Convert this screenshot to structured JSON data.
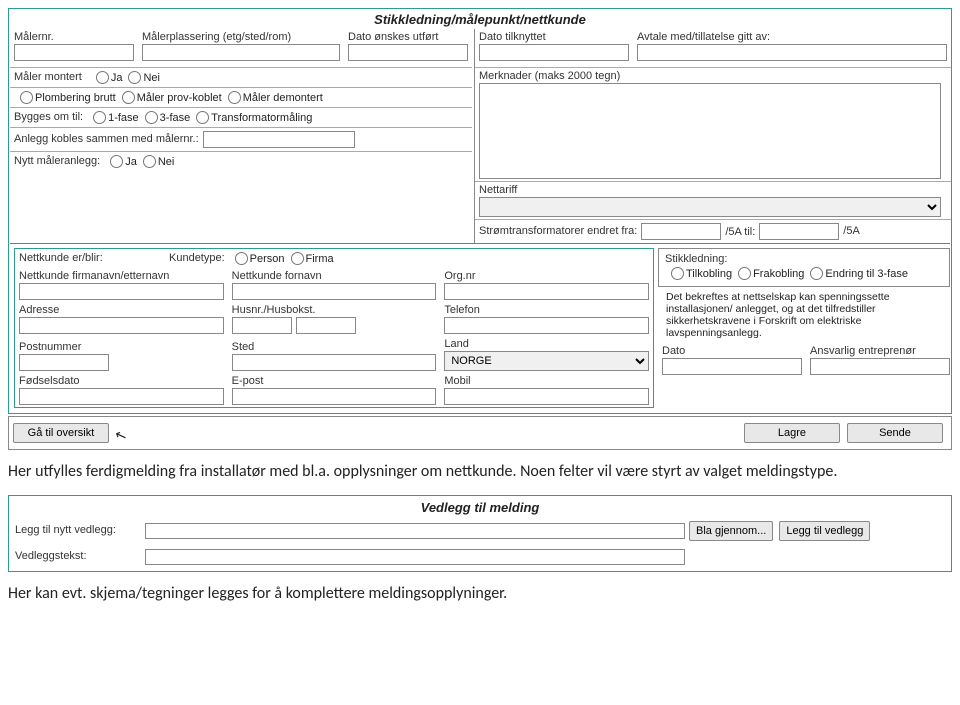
{
  "form1": {
    "title": "Stikkledning/målepunkt/nettkunde",
    "malernr": "Målernr.",
    "malerplassering": "Målerplassering (etg/sted/rom)",
    "dato_onsket": "Dato ønskes utført",
    "dato_tilknyttet": "Dato tilknyttet",
    "avtale": "Avtale med/tillatelse gitt av:",
    "merknader": "Merknader (maks 2000 tegn)",
    "maler_montert": "Måler montert",
    "ja": "Ja",
    "nei": "Nei",
    "plombering": "Plombering brutt",
    "provkoblet": "Måler prov-koblet",
    "demontert": "Måler demontert",
    "bygges_om": "Bygges om til:",
    "fase1": "1-fase",
    "fase3": "3-fase",
    "trafo": "Transformatormåling",
    "anlegg_kobles": "Anlegg kobles sammen med målernr.:",
    "nettariff": "Nettariff",
    "nytt_maler": "Nytt måleranlegg:",
    "stromtrans": "Strømtransformatorer endret fra:",
    "slash5a": "/5A til:",
    "slash5a2": "/5A",
    "nettkunde_erblir": "Nettkunde er/blir:",
    "kundetype": "Kundetype:",
    "person": "Person",
    "firma": "Firma",
    "stikkledning": "Stikkledning:",
    "tilkobling": "Tilkobling",
    "frakobling": "Frakobling",
    "endring3": "Endring til 3-fase",
    "firmanavn": "Nettkunde firmanavn/etternavn",
    "fornavn": "Nettkunde fornavn",
    "orgnr": "Org.nr",
    "bekreftes": "Det bekreftes at nettselskap kan spenningssette installasjonen/ anlegget, og at det tilfredstiller sikkerhetskravene i Forskrift om elektriske lavspenningsanlegg.",
    "adresse": "Adresse",
    "husnr": "Husnr./Husbokst.",
    "telefon": "Telefon",
    "postnummer": "Postnummer",
    "sted": "Sted",
    "land": "Land",
    "land_val": "NORGE",
    "fodselsdato": "Fødselsdato",
    "epost": "E-post",
    "mobil": "Mobil",
    "dato": "Dato",
    "ansvarlig": "Ansvarlig entreprenør"
  },
  "actions": {
    "oversikt": "Gå til oversikt",
    "lagre": "Lagre",
    "sende": "Sende"
  },
  "para1": "Her utfylles ferdigmelding fra installatør med bl.a. opplysninger om nettkunde. Noen felter vil være styrt av valget meldingstype.",
  "form2": {
    "title": "Vedlegg til melding",
    "leggtil": "Legg til nytt vedlegg:",
    "bla": "Bla gjennom...",
    "leggtilvedlegg": "Legg til vedlegg",
    "vedleggstekst": "Vedleggstekst:"
  },
  "para2": "Her kan evt. skjema/tegninger   legges  for å komplettere meldingsopplynger.",
  "para2_full": "Her kan evt. skjema/tegninger   legges  for å komplettere meldingsopplyninger."
}
